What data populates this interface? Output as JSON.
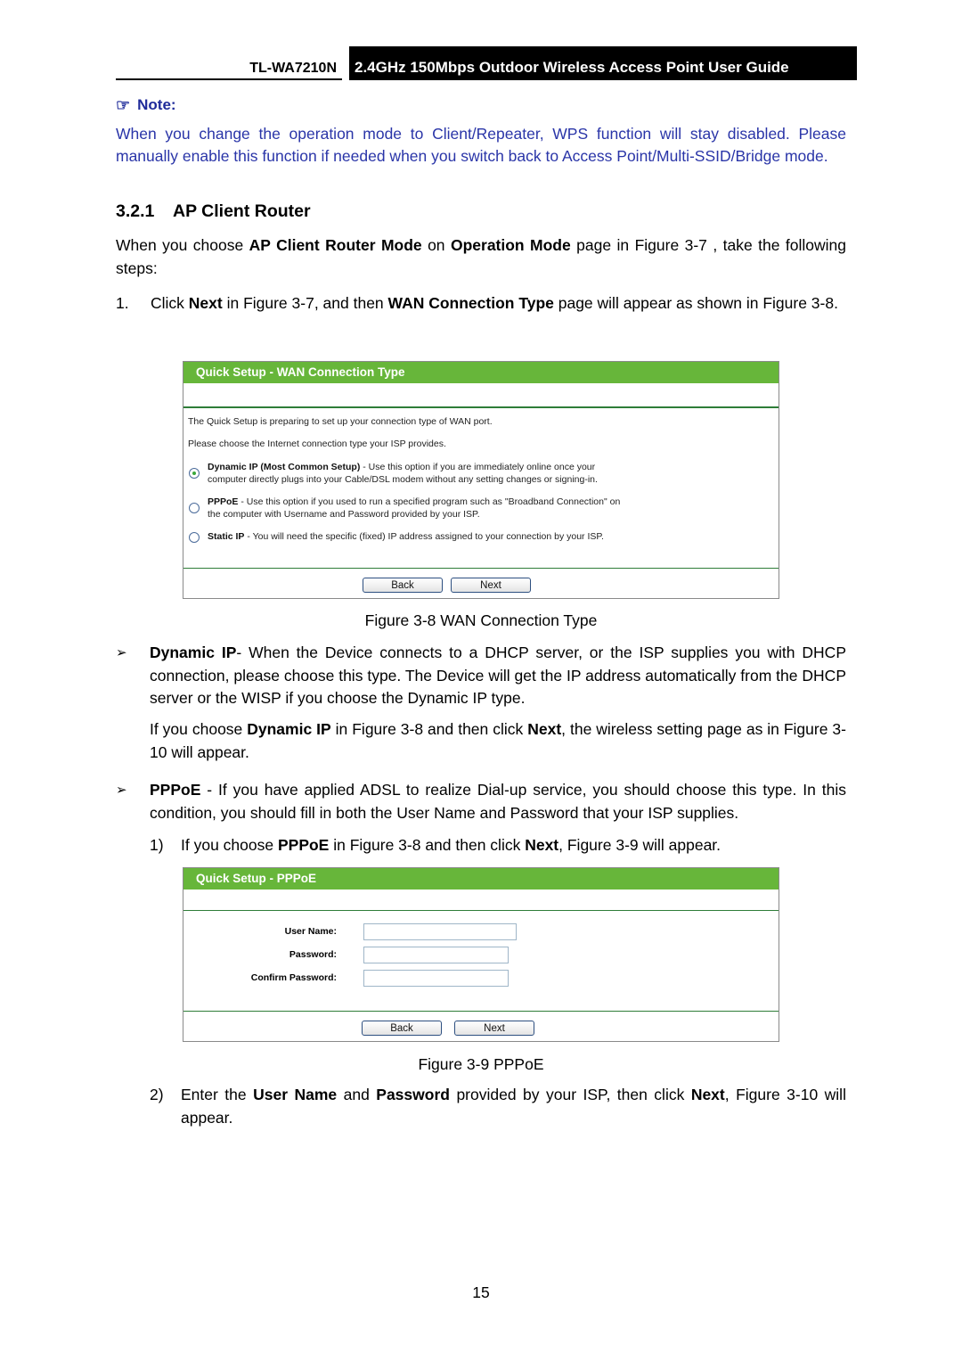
{
  "header": {
    "model": "TL-WA7210N",
    "title": "2.4GHz 150Mbps Outdoor Wireless Access Point User Guide"
  },
  "note": {
    "icon": "pointing-hand-icon",
    "label": "Note:",
    "text": "When you change the operation mode to Client/Repeater, WPS function will stay disabled. Please manually enable this function if needed when you switch back to Access Point/Multi-SSID/Bridge mode."
  },
  "section": {
    "number": "3.2.1",
    "title": "AP Client Router"
  },
  "intro": {
    "p1_a": "When you choose ",
    "p1_b1": "AP Client Router Mode",
    "p1_c": " on ",
    "p1_b2": "Operation Mode",
    "p1_d": " page in Figure 3-7 , take the following steps:"
  },
  "step1": {
    "num": "1.",
    "a": "Click ",
    "b1": "Next",
    "c": " in Figure 3-7, and then ",
    "b2": "WAN Connection Type",
    "d": " page will appear as shown in Figure 3-8."
  },
  "fig38": {
    "title": "Quick Setup - WAN Connection Type",
    "line1": "The Quick Setup is preparing to set up your connection type of WAN port.",
    "line2": "Please choose the Internet connection type your ISP provides.",
    "options": [
      {
        "label": "Dynamic IP (Most Common Setup)",
        "desc1": " - Use this option if you are immediately online once your",
        "desc2": "computer directly plugs into your Cable/DSL modem without any setting changes or signing-in.",
        "selected": true
      },
      {
        "label": "PPPoE",
        "desc1": " - Use this option if you used to run a specified program such as \"Broadband Connection\" on",
        "desc2": "the computer with Username and Password provided by your ISP.",
        "selected": false
      },
      {
        "label": "Static IP",
        "desc1": " - You will need the specific (fixed) IP address assigned to your connection by your ISP.",
        "desc2": "",
        "selected": false
      }
    ],
    "back": "Back",
    "next": "Next",
    "caption": "Figure 3-8 WAN Connection Type"
  },
  "dyn": {
    "bullet": "➢",
    "b": "Dynamic IP",
    "text": "- When the Device connects to a DHCP server, or the ISP supplies you with DHCP connection, please choose this type. The Device will get the IP address automatically from the DHCP server or the WISP if you choose the Dynamic IP type.",
    "p2_a": "If you choose ",
    "p2_b1": "Dynamic IP",
    "p2_c": " in Figure 3-8 and then click ",
    "p2_b2": "Next",
    "p2_d": ", the wireless setting page as in Figure 3-10 will appear."
  },
  "pppoe": {
    "bullet": "➢",
    "b": "PPPoE",
    "text": " - If you have applied ADSL to realize Dial-up service, you should choose this type. In this condition, you should fill in both the User Name and Password that your ISP supplies.",
    "s1_num": "1)",
    "s1_a": "If you choose ",
    "s1_b1": "PPPoE",
    "s1_c": " in Figure 3-8 and then click ",
    "s1_b2": "Next",
    "s1_d": ", Figure 3-9 will appear.",
    "s2_num": "2)",
    "s2_a": "Enter the ",
    "s2_b1": "User Name",
    "s2_c": " and ",
    "s2_b2": "Password",
    "s2_d": " provided by your ISP, then click ",
    "s2_b3": "Next",
    "s2_e": ", Figure 3-10 will appear."
  },
  "fig39": {
    "title": "Quick Setup - PPPoE",
    "user_label": "User Name:",
    "user_value": "",
    "pass_label": "Password:",
    "pass_value": "",
    "confirm_label": "Confirm Password:",
    "confirm_value": "",
    "back": "Back",
    "next": "Next",
    "caption": "Figure 3-9 PPPoE"
  },
  "page_number": "15"
}
